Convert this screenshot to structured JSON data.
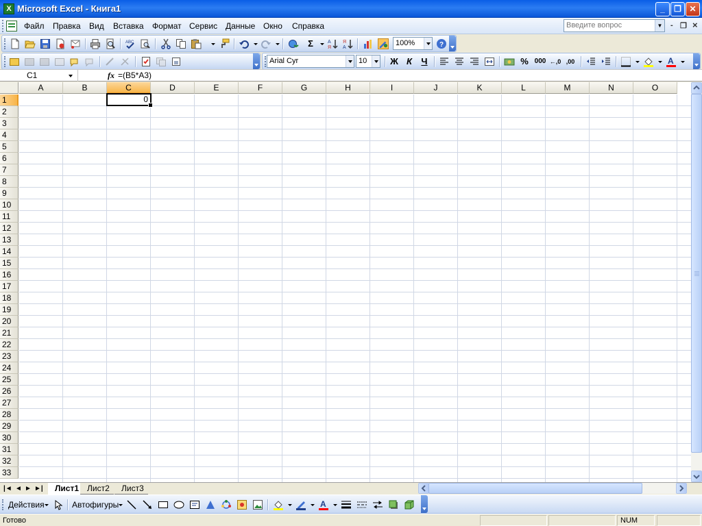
{
  "window": {
    "title": "Microsoft Excel - Книга1",
    "minimize": "_",
    "restore": "❐",
    "close": "✕"
  },
  "menu": {
    "items": [
      "Файл",
      "Правка",
      "Вид",
      "Вставка",
      "Формат",
      "Сервис",
      "Данные",
      "Окно",
      "Справка"
    ],
    "help_placeholder": "Введите вопрос",
    "mdi_minimize": "-",
    "mdi_restore": "❐",
    "mdi_close": "×"
  },
  "standard_toolbar": {
    "sum_symbol": "Σ",
    "zoom": "100%"
  },
  "formatting_toolbar": {
    "font_name": "Arial Cyr",
    "font_size": "10",
    "bold": "Ж",
    "italic": "К",
    "underline": "Ч",
    "percent": "%",
    "thousands": "000",
    "inc_decimal": "←,0",
    "dec_decimal": ",00"
  },
  "formula_bar": {
    "name_box": "C1",
    "fx": "fx",
    "formula": "=(B5*A3)"
  },
  "sheet": {
    "columns": [
      "A",
      "B",
      "C",
      "D",
      "E",
      "F",
      "G",
      "H",
      "I",
      "J",
      "K",
      "L",
      "M",
      "N",
      "O"
    ],
    "rows": [
      "1",
      "2",
      "3",
      "4",
      "5",
      "6",
      "7",
      "8",
      "9",
      "10",
      "11",
      "12",
      "13",
      "14",
      "15",
      "16",
      "17",
      "18",
      "19",
      "20",
      "21",
      "22",
      "23",
      "24",
      "25",
      "26",
      "27",
      "28",
      "29",
      "30",
      "31",
      "32",
      "33"
    ],
    "selected_column": "C",
    "selected_row": "1",
    "active_cell_value": "0",
    "tabs": [
      "Лист1",
      "Лист2",
      "Лист3"
    ],
    "active_tab": "Лист1"
  },
  "drawing_toolbar": {
    "actions": "Действия",
    "autoshapes": "Автофигуры"
  },
  "status_bar": {
    "status": "Готово",
    "num_indicator": "NUM"
  },
  "colors": {
    "title_bar": "#0a5ee6",
    "selected_header": "#f8b54a",
    "gridline": "#d0d7e5"
  }
}
